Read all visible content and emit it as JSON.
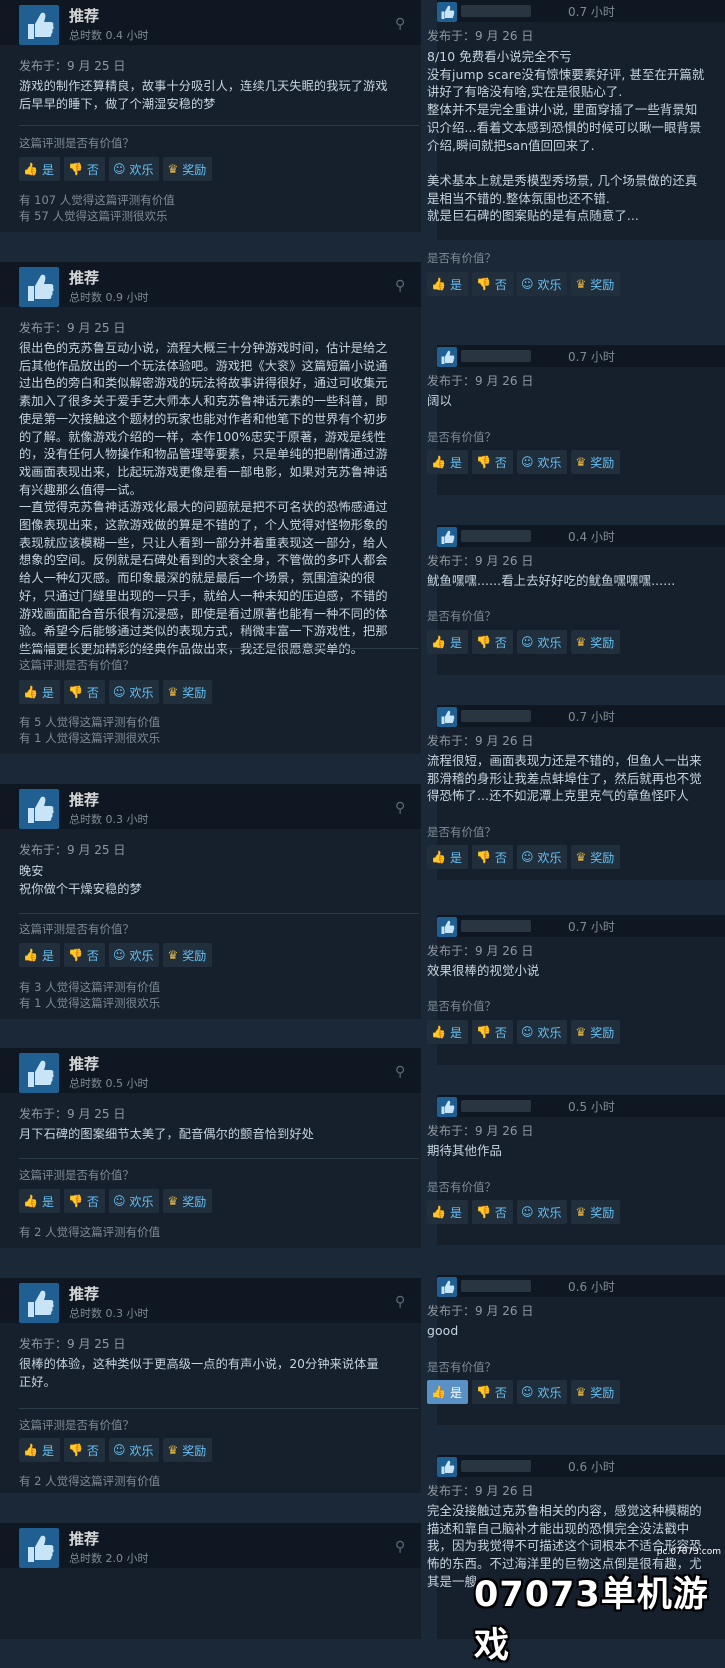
{
  "labels": {
    "recommended": "推荐",
    "helpful_q": "这篇评测是否有价值？",
    "helpful_q_short": "是否有价值？",
    "yes": "是",
    "no": "否",
    "funny": "欢乐",
    "award": "奖励"
  },
  "left_reviews": [
    {
      "hours": "总时数 0.4 小时",
      "posted": "发布于：9 月 25 日",
      "text": "游戏的制作还算精良，故事十分吸引人，连续几天失眠的我玩了游戏\n后早早的睡下，做了个潮湿安稳的梦",
      "stats": [
        "有 107 人觉得这篇评测有价值",
        "有 57 人觉得这篇评测很欢乐"
      ]
    },
    {
      "hours": "总时数 0.9 小时",
      "posted": "发布于：9 月 25 日",
      "text": "很出色的克苏鲁互动小说，流程大概三十分钟游戏时间，估计是给之\n后其他作品放出的一个玩法体验吧。游戏把《大衮》这篇短篇小说通\n过出色的旁白和类似解密游戏的玩法将故事讲得很好，通过可收集元\n素加入了很多关于爱手艺大师本人和克苏鲁神话元素的一些科普，即\n使是第一次接触这个题材的玩家也能对作者和他笔下的世界有个初步\n的了解。就像游戏介绍的一样，本作100%忠实于原著，游戏是线性\n的，没有任何人物操作和物品管理等要素，只是单纯的把剧情通过游\n戏画面表现出来，比起玩游戏更像是看一部电影，如果对克苏鲁神话\n有兴趣那么值得一试。\n一直觉得克苏鲁神话游戏化最大的问题就是把不可名状的恐怖感通过\n图像表现出来，这款游戏做的算是不错的了，个人觉得对怪物形象的\n表现就应该模糊一些，只让人看到一部分并着重表现这一部分，给人\n想象的空间。反例就是石碑处看到的大衮全身，不管做的多吓人都会\n给人一种幻灭感。而印象最深的就是最后一个场景，氛围渲染的很\n好，只通过门缝里出现的一只手，就给人一种未知的压迫感，不错的\n游戏画面配合音乐很有沉浸感，即使是看过原著也能有一种不同的体\n验。希望今后能够通过类似的表现方式，稍微丰富一下游戏性，把那\n些篇幅更长更加精彩的经典作品做出来，我还是很愿意买单的。",
      "stats": [
        "有 5 人觉得这篇评测有价值",
        "有 1 人觉得这篇评测很欢乐"
      ]
    },
    {
      "hours": "总时数 0.3 小时",
      "posted": "发布于：9 月 25 日",
      "text": "晚安\n祝你做个干燥安稳的梦",
      "stats": [
        "有 3 人觉得这篇评测有价值",
        "有 1 人觉得这篇评测很欢乐"
      ]
    },
    {
      "hours": "总时数 0.5 小时",
      "posted": "发布于：9 月 25 日",
      "text": "月下石碑的图案细节太美了，配音偶尔的颤音恰到好处",
      "stats": [
        "有 2 人觉得这篇评测有价值"
      ]
    },
    {
      "hours": "总时数 0.3 小时",
      "posted": "发布于：9 月 25 日",
      "text": "很棒的体验，这种类似于更高级一点的有声小说，20分钟来说体量\n正好。",
      "stats": [
        "有 2 人觉得这篇评测有价值"
      ]
    },
    {
      "hours": "总时数 2.0 小时"
    }
  ],
  "right_reviews": [
    {
      "hours": "0.7 小时",
      "posted": "发布于：9 月 26 日",
      "text": "8/10 免费看小说完全不亏\n没有jump scare没有惊悚要素好评, 甚至在开篇就\n讲好了有啥没有啥,实在是很贴心了.\n整体并不是完全重讲小说, 里面穿插了一些背景知\n识介绍...看着文本感到恐惧的时候可以瞅一眼背景\n介绍,瞬间就把san值回回来了.\n\n美术基本上就是秀模型秀场景, 几个场景做的还真\n是相当不错的.整体氛围也还不错.\n就是巨石碑的图案贴的是有点随意了..."
    },
    {
      "hours": "0.7 小时",
      "posted": "发布于：9 月 26 日",
      "text": "阔以"
    },
    {
      "hours": "0.4 小时",
      "posted": "发布于：9 月 26 日",
      "text": "鱿鱼嘿嘿......看上去好好吃的鱿鱼嘿嘿嘿......"
    },
    {
      "hours": "0.7 小时",
      "posted": "发布于：9 月 26 日",
      "text": "流程很短，画面表现力还是不错的，但鱼人一出来\n那滑稽的身形让我差点蚌埠住了，然后就再也不觉\n得恐怖了...还不如泥潭上克里克气的章鱼怪吓人"
    },
    {
      "hours": "0.7 小时",
      "posted": "发布于：9 月 26 日",
      "text": "效果很棒的视觉小说"
    },
    {
      "hours": "0.5 小时",
      "posted": "发布于：9 月 26 日",
      "text": "期待其他作品"
    },
    {
      "hours": "0.6 小时",
      "posted": "发布于：9 月 26 日",
      "text": "good"
    },
    {
      "hours": "0.6 小时",
      "posted": "发布于：9 月 26 日",
      "text": "完全没接触过克苏鲁相关的内容，感觉这种模糊的\n描述和靠自己脑补才能出现的恐惧完全没法戳中\n我，因为我觉得不可描述这个词根本不适合形容恐\n怖的东西。不过海洋里的巨物这点倒是很有趣，尤\n其是一艘..."
    }
  ],
  "watermark": {
    "url": "pc.07073.com",
    "logo": "07073单机游戏"
  }
}
